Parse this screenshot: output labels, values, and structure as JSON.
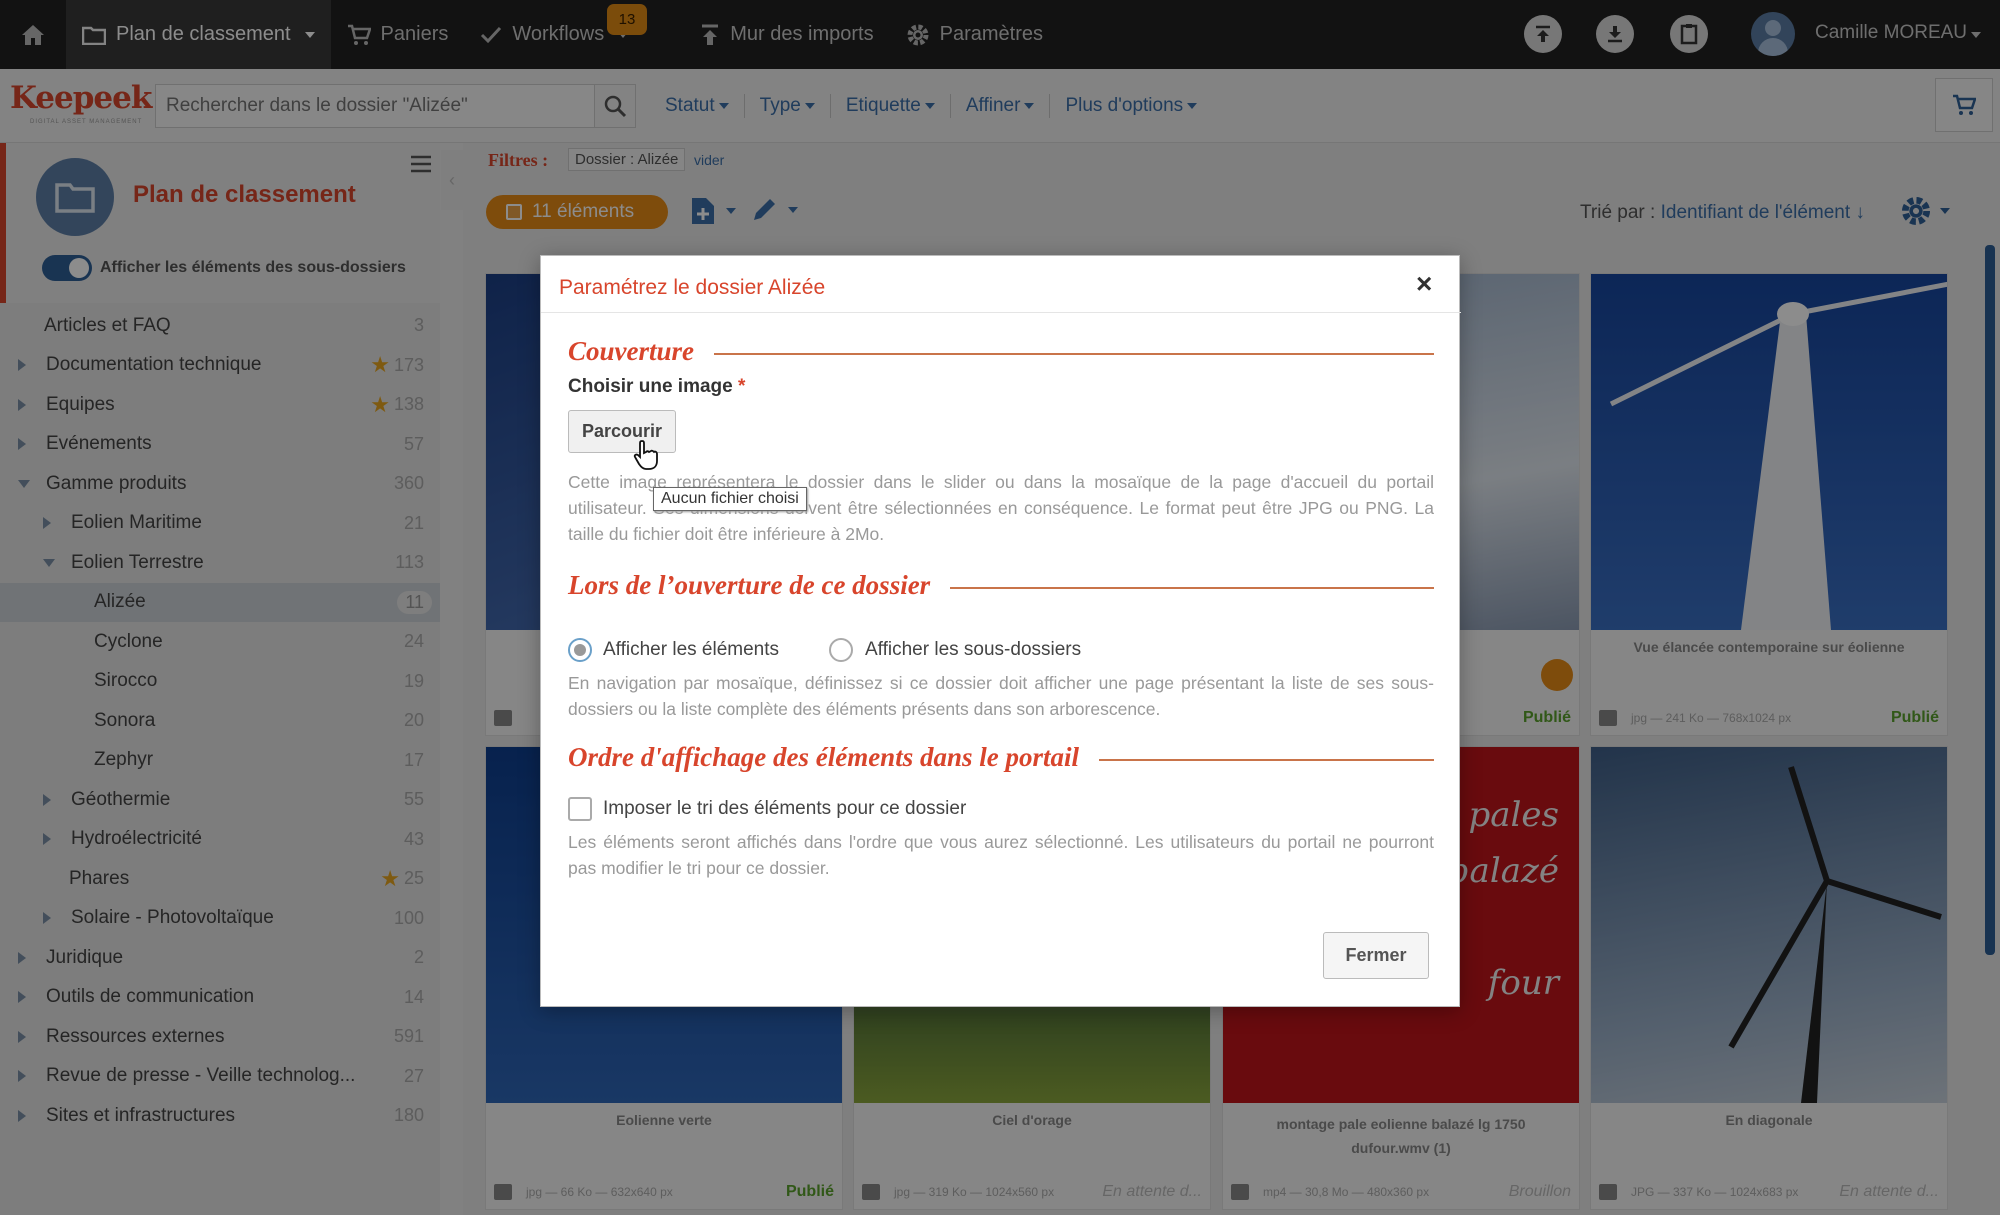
{
  "topnav": {
    "home": "home-icon",
    "classement": "Plan de classement",
    "paniers": "Paniers",
    "workflows": "Workflows",
    "workflows_badge": "13",
    "mur": "Mur des imports",
    "parametres": "Paramètres",
    "user": "Camille MOREAU"
  },
  "search": {
    "placeholder": "Rechercher dans le dossier \"Alizée\"",
    "filters": [
      "Statut",
      "Type",
      "Etiquette",
      "Affiner",
      "Plus d'options"
    ]
  },
  "logo": {
    "text": "Keepeek",
    "sub": "DIGITAL ASSET MANAGEMENT"
  },
  "sidebar": {
    "title": "Plan de classement",
    "toggle_label": "Afficher les éléments des sous-dossiers",
    "items": [
      {
        "label": "Articles et FAQ",
        "count": "3"
      },
      {
        "label": "Documentation technique",
        "count": "173"
      },
      {
        "label": "Equipes",
        "count": "138"
      },
      {
        "label": "Evénements",
        "count": "57"
      },
      {
        "label": "Gamme produits",
        "count": "360"
      },
      {
        "label": "Eolien Maritime",
        "count": "21"
      },
      {
        "label": "Eolien Terrestre",
        "count": "113"
      },
      {
        "label": "Alizée",
        "count": "11"
      },
      {
        "label": "Cyclone",
        "count": "24"
      },
      {
        "label": "Sirocco",
        "count": "19"
      },
      {
        "label": "Sonora",
        "count": "20"
      },
      {
        "label": "Zephyr",
        "count": "17"
      },
      {
        "label": "Géothermie",
        "count": "55"
      },
      {
        "label": "Hydroélectricité",
        "count": "43"
      },
      {
        "label": "Phares",
        "count": "25"
      },
      {
        "label": "Solaire - Photovoltaïque",
        "count": "100"
      },
      {
        "label": "Juridique",
        "count": "2"
      },
      {
        "label": "Outils de communication",
        "count": "14"
      },
      {
        "label": "Ressources externes",
        "count": "591"
      },
      {
        "label": "Revue de presse - Veille technolog...",
        "count": "27"
      },
      {
        "label": "Sites et infrastructures",
        "count": "180"
      }
    ]
  },
  "toolbar": {
    "filtres_label": "Filtres :",
    "chip": "Dossier : Alizée",
    "vider": "vider",
    "count": "11 éléments",
    "sort_label": "Trié par :",
    "sort_value": "Identifiant de l'élément ↓"
  },
  "cards": [
    {
      "caption": "Vue élancée contemporaine sur éolienne",
      "meta": "jpg — 241 Ko — 768x1024 px",
      "status": "Publié"
    },
    {
      "caption": "Eolienne verte",
      "meta": "jpg — 66 Ko — 632x640 px",
      "status": "Publié"
    },
    {
      "caption": "Ciel d'orage",
      "meta": "jpg — 319 Ko — 1024x560 px",
      "status": "En attente d..."
    },
    {
      "caption": "montage pale eolienne balazé lg 1750 dufour.wmv (1)",
      "meta": "mp4 — 30,8 Mo — 480x360 px",
      "status": "Brouillon"
    },
    {
      "caption": "En diagonale",
      "meta": "JPG — 337 Ko — 1024x683 px",
      "status": "En attente d..."
    },
    {
      "status": "Publié"
    }
  ],
  "card_overlay_text": [
    "pales",
    "balazé",
    "four"
  ],
  "modal": {
    "title": "Paramétrez le dossier Alizée",
    "close": "×",
    "sec1": "Couverture",
    "choose_label": "Choisir une image",
    "required": "*",
    "browse": "Parcourir",
    "tooltip": "Aucun fichier choisi",
    "help1": "Cette image représentera le dossier dans le slider ou dans la mosaïque de la page d'accueil du portail utilisateur. Ses dimensions doivent être sélectionnées en conséquence. Le format peut être JPG ou PNG. La taille du fichier doit être inférieure à 2Mo.",
    "sec2": "Lors de l’ouverture de ce dossier",
    "radio1": "Afficher les éléments",
    "radio2": "Afficher les sous-dossiers",
    "help2": "En navigation par mosaïque, définissez si ce dossier doit afficher une page présentant la liste de ses sous-dossiers ou la liste complète des éléments présents dans son arborescence.",
    "sec3": "Ordre d'affichage des éléments dans le portail",
    "checkbox": "Imposer le tri des éléments pour ce dossier",
    "help3": "Les éléments seront affichés dans l'ordre que vous aurez sélectionné. Les utilisateurs du portail ne pourront pas modifier le tri pour ce dossier.",
    "fermer": "Fermer"
  }
}
